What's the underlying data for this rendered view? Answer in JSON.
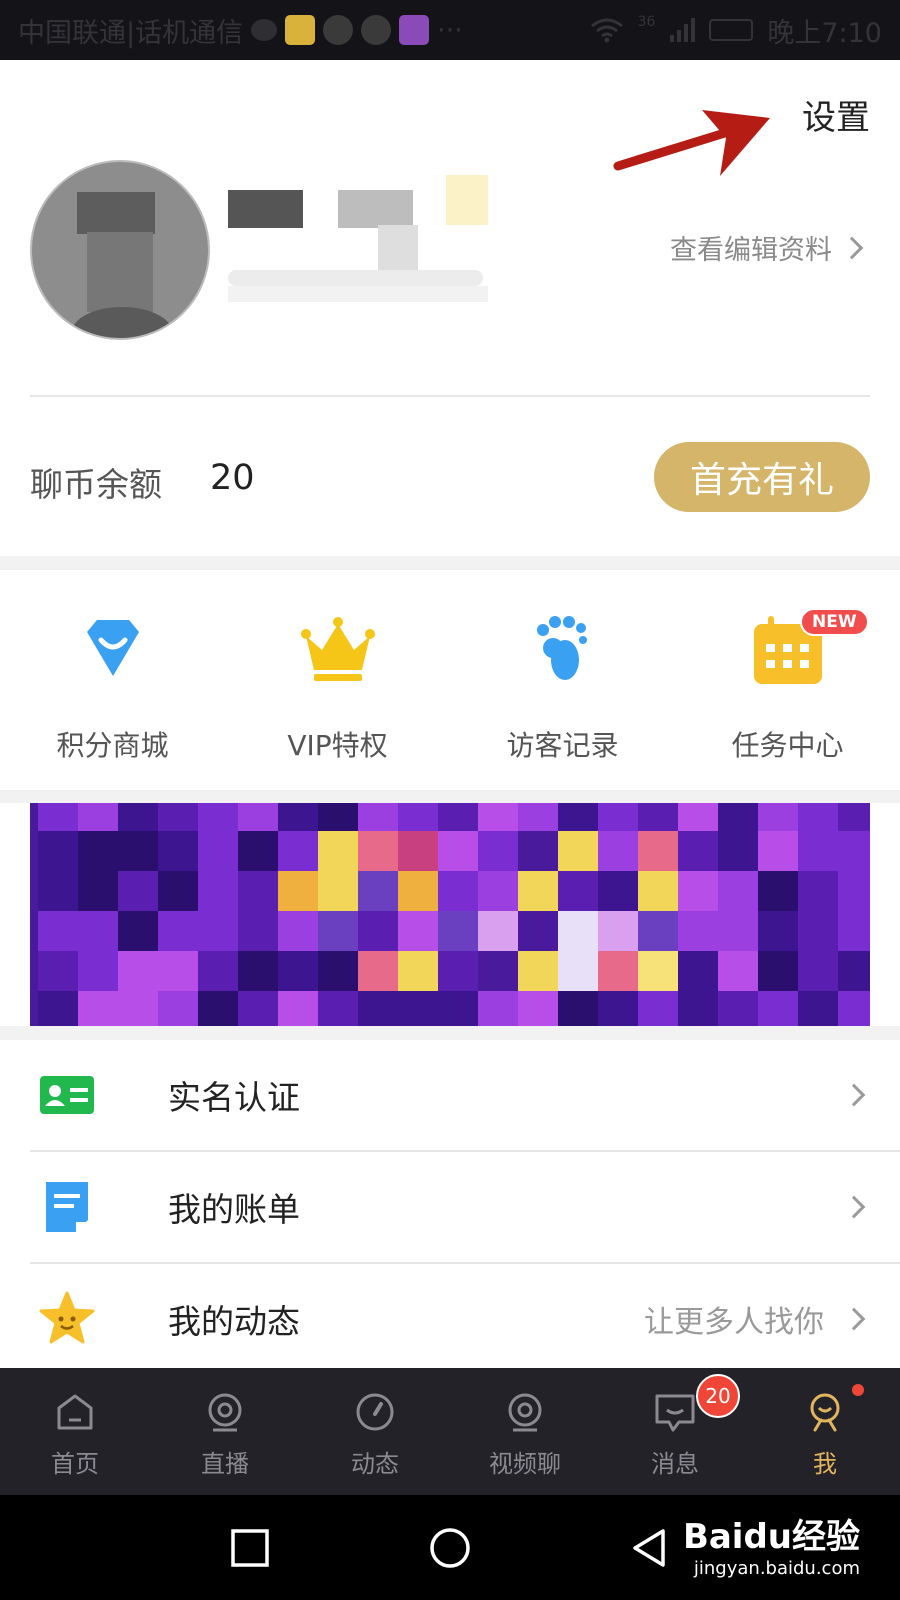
{
  "status_bar": {
    "carrier": "中国联通|话机通信",
    "network": "36",
    "time": "晚上7:10",
    "overflow": "···"
  },
  "header": {
    "settings_label": "设置"
  },
  "profile": {
    "edit_label": "查看编辑资料"
  },
  "balance": {
    "label": "聊币余额",
    "value": "20",
    "recharge_label": "首充有礼"
  },
  "grid_menu": {
    "items": [
      {
        "label": "积分商城",
        "icon": "shopping-bag-icon"
      },
      {
        "label": "VIP特权",
        "icon": "crown-icon"
      },
      {
        "label": "访客记录",
        "icon": "footprint-icon"
      },
      {
        "label": "任务中心",
        "icon": "calendar-icon",
        "badge": "NEW"
      }
    ]
  },
  "list": {
    "items": [
      {
        "label": "实名认证",
        "icon": "id-card-icon",
        "right_text": ""
      },
      {
        "label": "我的账单",
        "icon": "document-icon",
        "right_text": ""
      },
      {
        "label": "我的动态",
        "icon": "star-icon",
        "right_text": "让更多人找你"
      }
    ]
  },
  "bottom_nav": {
    "items": [
      {
        "label": "首页",
        "icon": "home-icon"
      },
      {
        "label": "直播",
        "icon": "live-camera-icon"
      },
      {
        "label": "动态",
        "icon": "compass-icon"
      },
      {
        "label": "视频聊",
        "icon": "video-chat-icon"
      },
      {
        "label": "消息",
        "icon": "message-icon",
        "badge": "20"
      },
      {
        "label": "我",
        "icon": "me-icon",
        "active": true
      }
    ]
  },
  "watermark": {
    "main": "Baidu经验",
    "sub": "jingyan.baidu.com"
  },
  "colors": {
    "accent_gold": "#d4b56a",
    "nav_active": "#e2b45e",
    "badge_red": "#f04638",
    "nav_background": "#232229"
  }
}
